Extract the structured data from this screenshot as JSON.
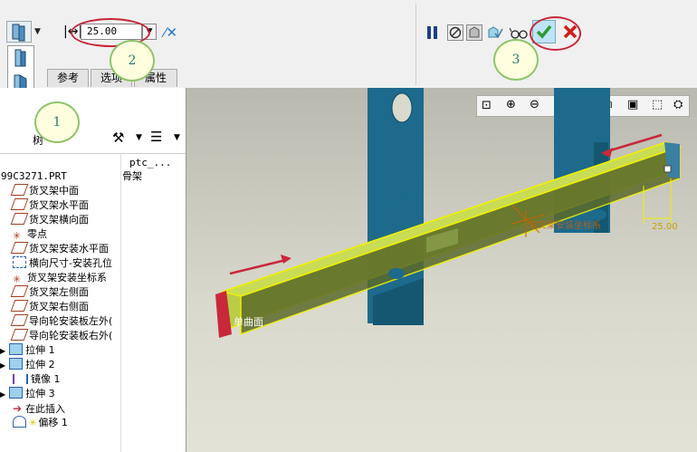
{
  "dashboard": {
    "depth_value": "25.00",
    "tabs": [
      "参考",
      "选项",
      "属性"
    ],
    "callouts": [
      "1",
      "2",
      "3"
    ]
  },
  "tree": {
    "tools_header": "树",
    "column_header": "ptc_...",
    "part_name": "99C3271.PRT",
    "part_value": "骨架",
    "items": [
      "货叉架中面",
      "货叉架水平面",
      "货叉架横向面",
      "零点",
      "货叉架安装水平面",
      "横向尺寸-安装孔位",
      "货叉架安装坐标系",
      "货叉架左侧面",
      "货叉架右侧面",
      "导向轮安装板左外(",
      "导向轮安装板右外(",
      "拉伸 1",
      "拉伸 2",
      "镜像 1",
      "拉伸 3",
      "在此插入",
      "偏移 1"
    ]
  },
  "viewport": {
    "dimension_label": "25.00",
    "surface_label": "单曲面",
    "csys_label": "货叉架安装坐标系"
  },
  "colors": {
    "beam_fill": "#b7cc3c",
    "upright": "#1d6a8c",
    "highlight": "#f0f000",
    "arrow": "#c8283a",
    "confirm": "#2e9b2e",
    "cancel": "#d21c1c"
  }
}
